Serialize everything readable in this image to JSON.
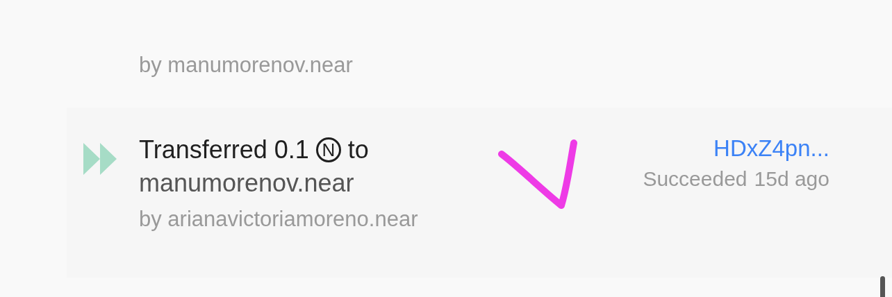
{
  "transactions": [
    {
      "author": "by manumorenov.near"
    },
    {
      "action": "Transferred 0.1",
      "token": "N",
      "preposition": "to",
      "receiver": "manumorenov.near",
      "author": "by arianavictoriamoreno.near",
      "hash": "HDxZ4pn...",
      "status": "Succeeded",
      "age": "15d ago"
    }
  ]
}
